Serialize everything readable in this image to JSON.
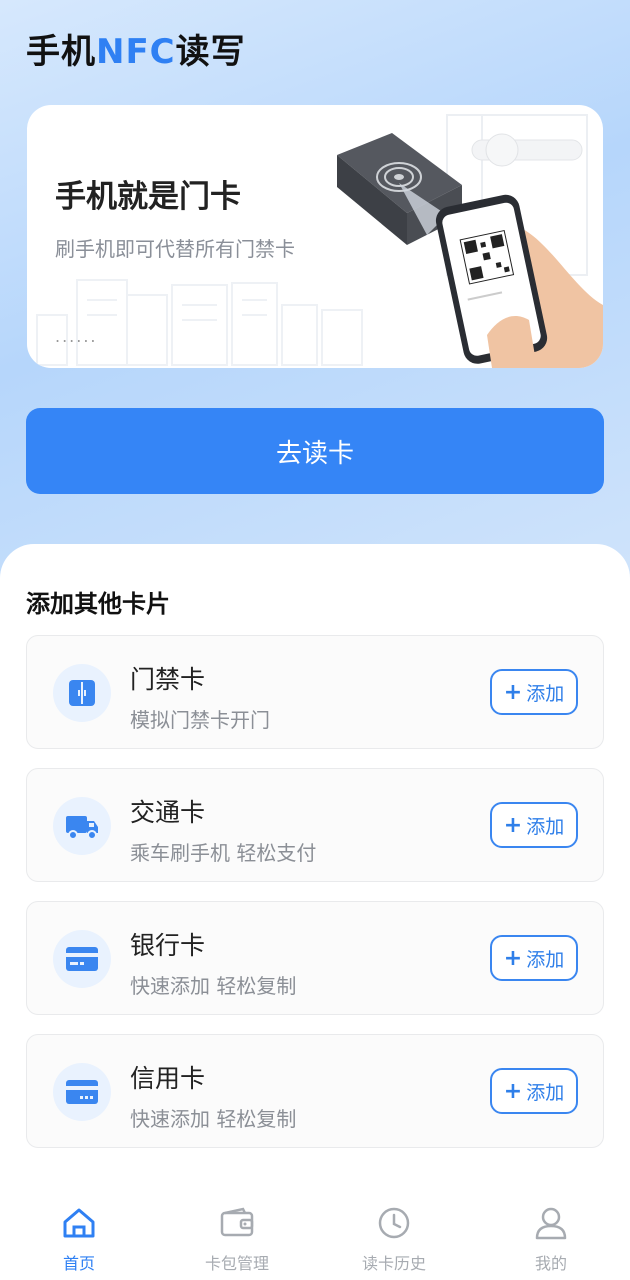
{
  "header": {
    "title_prefix": "手机",
    "title_accent": "NFC",
    "title_suffix": "读写"
  },
  "banner": {
    "title": "手机就是门卡",
    "subtitle": "刷手机即可代替所有门禁卡",
    "dots": "......"
  },
  "read_button": {
    "label": "去读卡"
  },
  "section": {
    "title": "添加其他卡片"
  },
  "cards": [
    {
      "name": "门禁卡",
      "desc": "模拟门禁卡开门",
      "add": "添加",
      "icon": "door-icon"
    },
    {
      "name": "交通卡",
      "desc": "乘车刷手机 轻松支付",
      "add": "添加",
      "icon": "truck-icon"
    },
    {
      "name": "银行卡",
      "desc": "快速添加 轻松复制",
      "add": "添加",
      "icon": "bank-card-icon"
    },
    {
      "name": "信用卡",
      "desc": "快速添加 轻松复制",
      "add": "添加",
      "icon": "credit-card-icon"
    }
  ],
  "tabs": [
    {
      "label": "首页",
      "icon": "home-icon",
      "active": true
    },
    {
      "label": "卡包管理",
      "icon": "wallet-icon",
      "active": false
    },
    {
      "label": "读卡历史",
      "icon": "clock-icon",
      "active": false
    },
    {
      "label": "我的",
      "icon": "user-icon",
      "active": false
    }
  ],
  "colors": {
    "accent": "#3585f6",
    "tab_active": "#2f80f3",
    "tab_inactive": "#a7abb1"
  }
}
